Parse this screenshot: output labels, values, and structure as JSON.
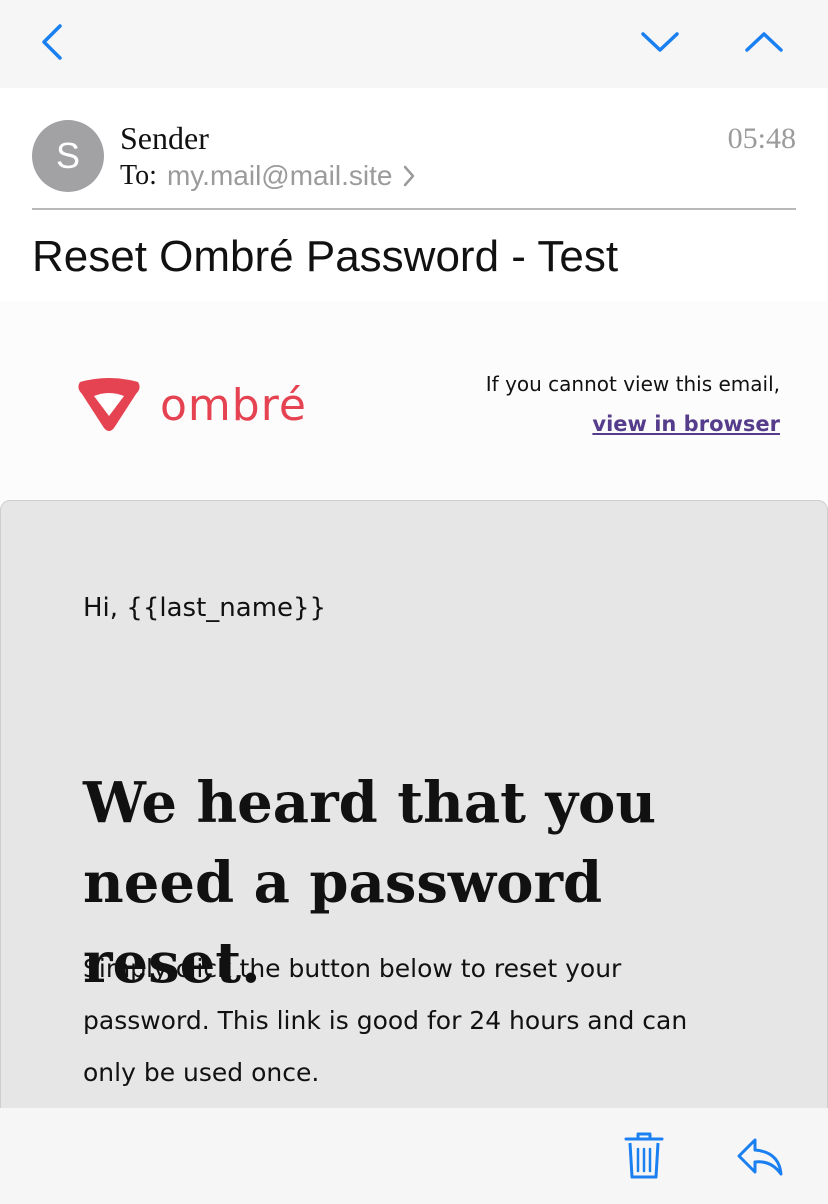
{
  "toolbar": {
    "back_icon": "chevron-left-icon",
    "next_icon": "chevron-down-icon",
    "prev_icon": "chevron-up-icon"
  },
  "message": {
    "avatar_initial": "S",
    "sender": "Sender",
    "to_label": "To:",
    "to_address": "my.mail@mail.site",
    "time": "05:48",
    "subject": "Reset Ombré Password - Test"
  },
  "email": {
    "brand": "ombré",
    "cannot_view": "If you cannot view this email,",
    "view_in_browser": "view in browser",
    "greeting": "Hi, {{last_name}}",
    "headline": "We heard that you need a password reset.",
    "body": "Simply click the button below to reset your password. This link is good for 24 hours and can only be used once."
  },
  "colors": {
    "accent": "#1a7ff0",
    "brand": "#e64352",
    "link": "#553d8c"
  },
  "bottom": {
    "trash_icon": "trash-icon",
    "reply_icon": "reply-icon"
  }
}
